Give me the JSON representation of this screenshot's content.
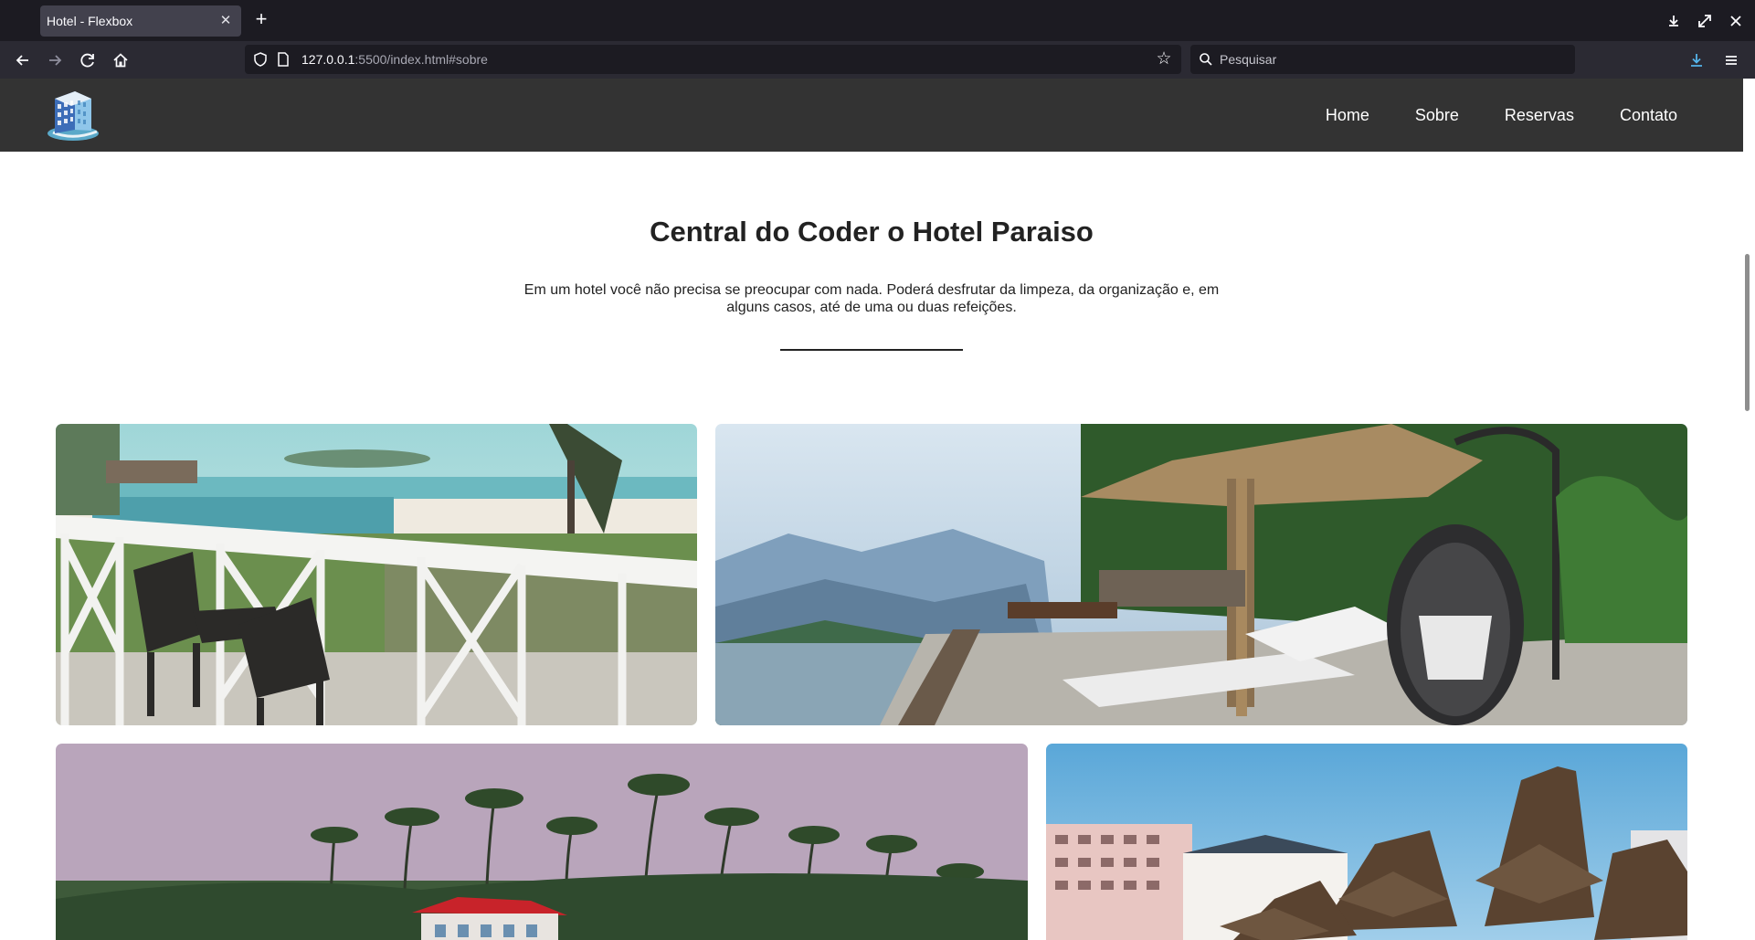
{
  "browser": {
    "tab_title": "Hotel - Flexbox",
    "url_host": "127.0.0.1",
    "url_rest": ":5500/index.html#sobre",
    "search_placeholder": "Pesquisar"
  },
  "site": {
    "nav": [
      "Home",
      "Sobre",
      "Reservas",
      "Contato"
    ]
  },
  "about": {
    "title": "Central do Coder o Hotel Paraiso",
    "text": "Em um hotel você não precisa se preocupar com nada. Poderá desfrutar da limpeza, da organização e, em alguns casos, até de uma ou duas refeições."
  },
  "gallery": {
    "photos": [
      "balcony-beach-view-photo",
      "mountain-terrace-hanging-chair-photo",
      "palm-trees-resort-photo",
      "thatched-umbrellas-hotel-photo"
    ]
  },
  "colors": {
    "site_header_bg": "#333333",
    "browser_tab_bg": "#1c1b22",
    "browser_toolbar_bg": "#2b2a33"
  }
}
